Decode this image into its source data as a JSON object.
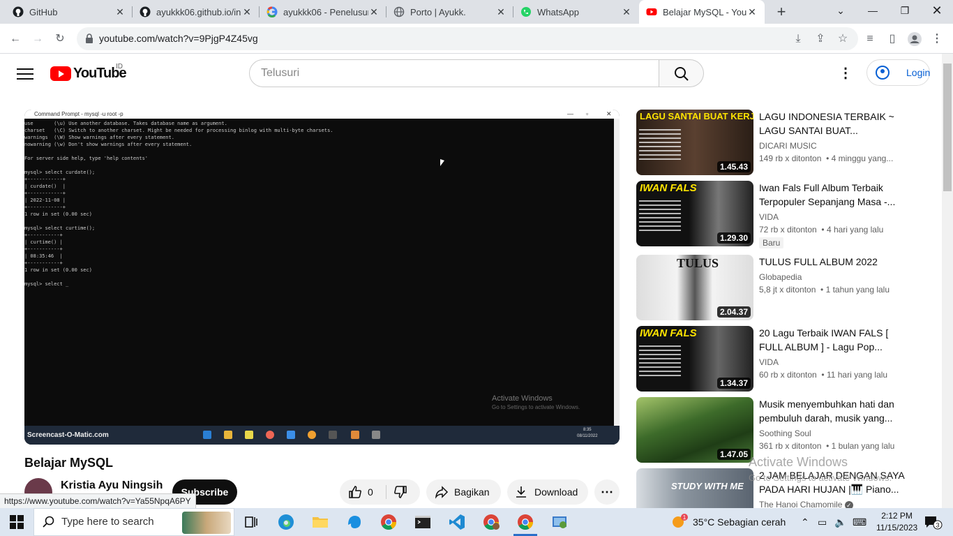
{
  "browser": {
    "tabs": [
      {
        "title": "GitHub",
        "icon": "github-icon",
        "active": false
      },
      {
        "title": "ayukkk06.github.io/in",
        "icon": "github-icon",
        "active": false
      },
      {
        "title": "ayukkk06 - Penelusur",
        "icon": "google-icon",
        "active": false
      },
      {
        "title": "Porto | Ayukk.",
        "icon": "globe-icon",
        "active": false
      },
      {
        "title": "WhatsApp",
        "icon": "whatsapp-icon",
        "active": false
      },
      {
        "title": "Belajar MySQL - YouT",
        "icon": "youtube-icon",
        "active": true
      }
    ],
    "url": "youtube.com/watch?v=9PjgP4Z45vg",
    "status_url": "https://www.youtube.com/watch?v=Ya55NpqA6PY"
  },
  "youtube": {
    "logo_text": "YouTube",
    "country_code": "ID",
    "search_placeholder": "Telusuri",
    "login_label": "Login"
  },
  "video": {
    "title": "Belajar MySQL",
    "channel": "Kristia Ayu Ningsih",
    "subscribe_label": "Subscribe",
    "likes": "0",
    "share_label": "Bagikan",
    "download_label": "Download",
    "cmd_title": "Command Prompt - mysql -u root -p",
    "cmd_text": "use       (\\u) Use another database. Takes database name as argument.\ncharset   (\\C) Switch to another charset. Might be needed for processing binlog with multi-byte charsets.\nwarnings  (\\W) Show warnings after every statement.\nnowarning (\\w) Don't show warnings after every statement.\n\nFor server side help, type 'help contents'\n\nmysql> select curdate();\n+------------+\n| curdate()  |\n+------------+\n| 2022-11-08 |\n+------------+\n1 row in set (0.00 sec)\n\nmysql> select curtime();\n+-----------+\n| curtime() |\n+-----------+\n| 08:35:46  |\n+-----------+\n1 row in set (0.00 sec)\n\nmysql> select _",
    "watermark_title": "Activate Windows",
    "watermark_sub": "Go to Settings to activate Windows.",
    "screencast_label": "Screencast-O-Matic.com",
    "video_time": "8:35",
    "video_date": "08/11/2022"
  },
  "recommendations": [
    {
      "title": "LAGU INDONESIA TERBAIK ~ LAGU SANTAI BUAT...",
      "channel": "DICARI MUSIC",
      "views": "149 rb x ditonton",
      "age": "4 minggu yang...",
      "duration": "1.45.43",
      "thumb_text": "LAGU SANTAI BUAT KERJA",
      "thumb_color": "#3b2d22",
      "badge": ""
    },
    {
      "title": "Iwan Fals Full Album Terbaik Terpopuler Sepanjang Masa -...",
      "channel": "VIDA",
      "views": "72 rb x ditonton",
      "age": "4 hari yang lalu",
      "duration": "1.29.30",
      "thumb_text": "IWAN FALS",
      "thumb_color": "#1a1a1a",
      "badge": "Baru"
    },
    {
      "title": "TULUS FULL ALBUM 2022",
      "channel": "Globapedia",
      "views": "5,8 jt x ditonton",
      "age": "1 tahun yang lalu",
      "duration": "2.04.37",
      "thumb_text": "TULUS",
      "thumb_color": "#e8e8e8",
      "badge": ""
    },
    {
      "title": "20 Lagu Terbaik IWAN FALS [ FULL ALBUM ] - Lagu Pop...",
      "channel": "VIDA",
      "views": "60 rb x ditonton",
      "age": "11 hari yang lalu",
      "duration": "1.34.37",
      "thumb_text": "IWAN FALS",
      "thumb_color": "#1a1a1a",
      "badge": ""
    },
    {
      "title": "Musik menyembuhkan hati dan pembuluh darah, musik yang...",
      "channel": "Soothing Soul",
      "views": "361 rb x ditonton",
      "age": "1 bulan yang lalu",
      "duration": "1.47.05",
      "thumb_text": "",
      "thumb_color": "#3d6b2a",
      "badge": ""
    },
    {
      "title": "2 JAM BELAJAR DENGAN SAYA PADA HARI HUJAN |🎹 Piano...",
      "channel": "The Hanoi Chamomile",
      "views": "",
      "age": "",
      "duration": "",
      "thumb_text": "STUDY WITH ME",
      "thumb_color": "#5a6470",
      "badge": ""
    }
  ],
  "page_watermark": {
    "title": "Activate Windows",
    "sub": "Go to Settings to activate Windows."
  },
  "taskbar": {
    "search_placeholder": "Type here to search",
    "weather": "35°C  Sebagian cerah",
    "time": "2:12 PM",
    "date": "11/15/2023",
    "notification_count": "3"
  }
}
